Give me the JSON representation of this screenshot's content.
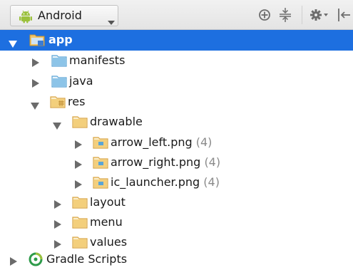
{
  "toolbar": {
    "view_mode": "Android",
    "icons": [
      "target-icon",
      "collapse-all-icon",
      "gear-icon",
      "hide-icon"
    ]
  },
  "tree": {
    "app": "app",
    "manifests": "manifests",
    "java": "java",
    "res": "res",
    "drawable": "drawable",
    "arrow_left": "arrow_left.png",
    "arrow_left_count": "(4)",
    "arrow_right": "arrow_right.png",
    "arrow_right_count": "(4)",
    "ic_launcher": "ic_launcher.png",
    "ic_launcher_count": "(4)",
    "layout": "layout",
    "menu": "menu",
    "values": "values",
    "gradle_scripts": "Gradle Scripts"
  },
  "colors": {
    "selection": "#1d6fe0",
    "folder": "#5aa5d6",
    "res_folder": "#d9a441",
    "android_green": "#9bc13c"
  }
}
